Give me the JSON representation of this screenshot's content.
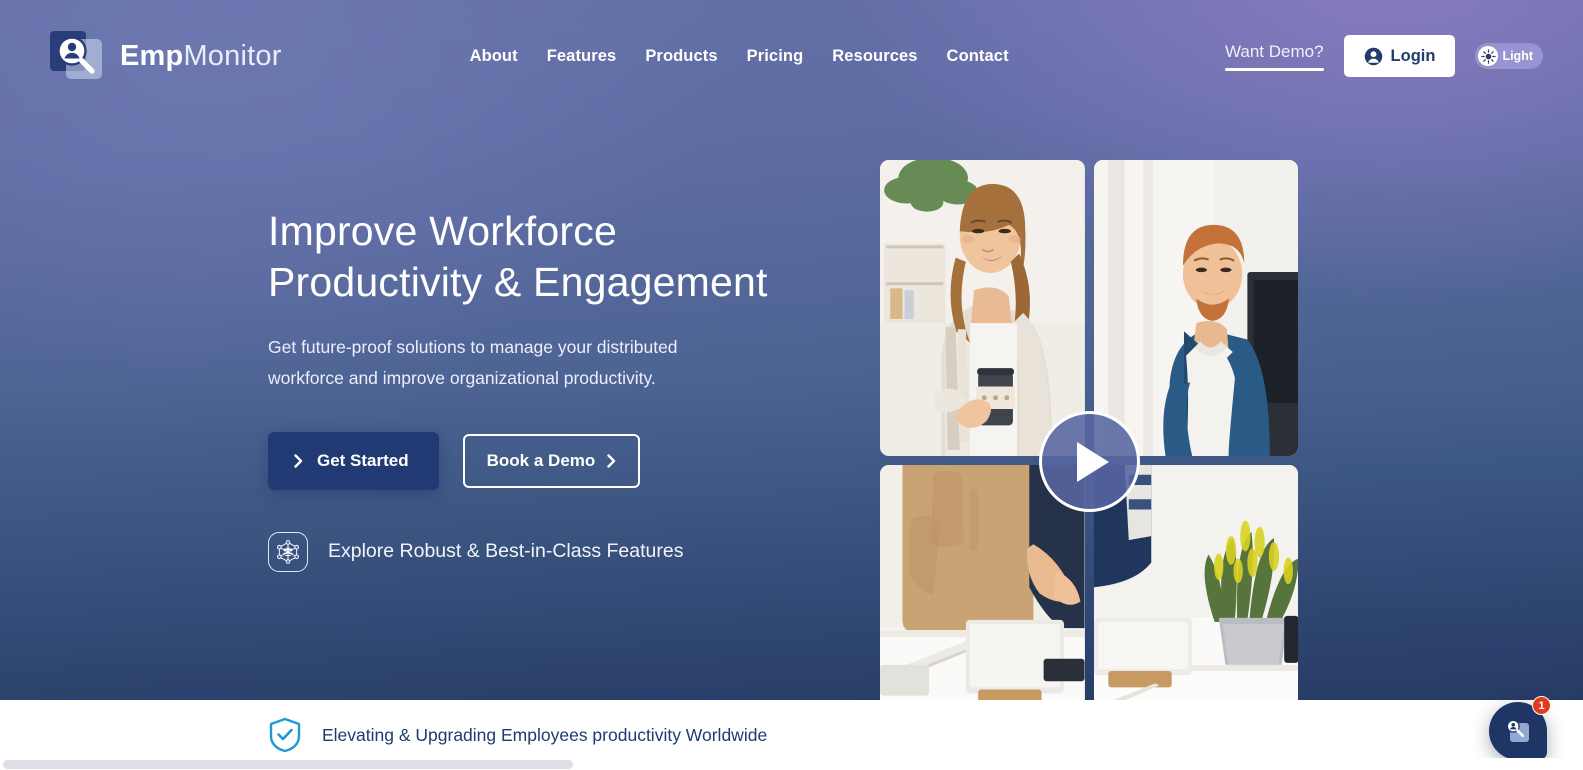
{
  "brand": {
    "name_bold": "Emp",
    "name_light": "Monitor",
    "logo_icon": "magnifier-person-logo-icon",
    "accent_dark": "#223a73",
    "accent_mid": "#5665a0",
    "shield_blue": "#1b9ad6",
    "badge_red": "#e03a21"
  },
  "nav": {
    "items": [
      {
        "label": "About"
      },
      {
        "label": "Features"
      },
      {
        "label": "Products"
      },
      {
        "label": "Pricing"
      },
      {
        "label": "Resources"
      },
      {
        "label": "Contact"
      }
    ]
  },
  "header": {
    "demo_link": "Want Demo?",
    "login_label": "Login",
    "login_icon": "user-circle-icon",
    "theme_label": "Light",
    "theme_icon": "sun-icon"
  },
  "hero": {
    "headline_line1": "Improve  Workforce",
    "headline_line2": "Productivity & Engagement",
    "subcopy": "Get future-proof solutions to manage your distributed workforce and improve organizational productivity.",
    "primary_cta": "Get Started",
    "primary_cta_icon": "chevron-right-icon",
    "secondary_cta": "Book a Demo",
    "secondary_cta_icon": "chevron-right-icon",
    "explore_label": "Explore Robust & Best-in-Class Features",
    "explore_icon": "network-nodes-people-icon",
    "play_icon": "play-triangle-icon"
  },
  "photos": [
    {
      "alt": "woman-with-coffee-smiling"
    },
    {
      "alt": "bearded-man-at-monitor"
    },
    {
      "alt": "person-in-beige-trousers-at-desk"
    },
    {
      "alt": "desk-with-plant-and-keyboard"
    }
  ],
  "bottom_bar": {
    "text": "Elevating & Upgrading Employees productivity Worldwide",
    "icon": "shield-check-icon"
  },
  "chat": {
    "badge_count": "1",
    "icon": "empmonitor-chat-icon"
  }
}
